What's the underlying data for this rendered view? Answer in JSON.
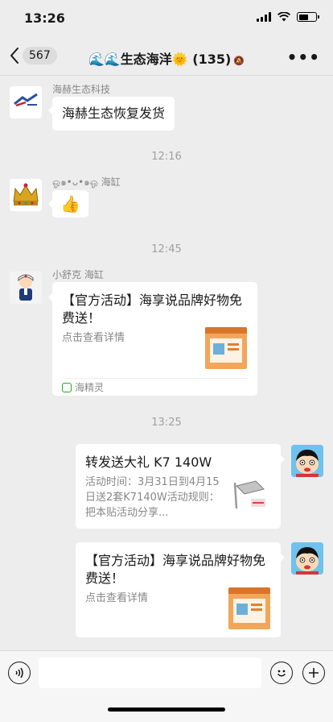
{
  "status_bar": {
    "time": "13:26"
  },
  "nav": {
    "unread_count": "567",
    "title": "🌊🌊生态海洋🌞 (135)",
    "more_label": "•••"
  },
  "messages": [
    {
      "sender": "海赫生态科技",
      "text": "海赫生态恢复发货"
    },
    {
      "time": "12:16",
      "sender": "ஓ๑•ᴗ•๑ஓ 海缸",
      "emoji": "👍"
    },
    {
      "time": "12:45",
      "sender": "小舒克 海缸",
      "card_title": "【官方活动】海享说品牌好物免费送！",
      "card_desc": "点击查看详情",
      "card_source": "海精灵"
    },
    {
      "time": "13:25",
      "card_title": "转发送大礼 K7 140W",
      "card_desc": "活动时间：3月31日到4月15日送2套K7140W活动规则：把本贴活动分享..."
    },
    {
      "card_title": "【官方活动】海享说品牌好物免费送！",
      "card_desc": "点击查看详情"
    }
  ],
  "input": {
    "placeholder": ""
  },
  "colors": {
    "background": "#ededed",
    "bubble": "#ffffff",
    "time_text": "#a0a0a0",
    "wechat_green": "#1aad19"
  }
}
